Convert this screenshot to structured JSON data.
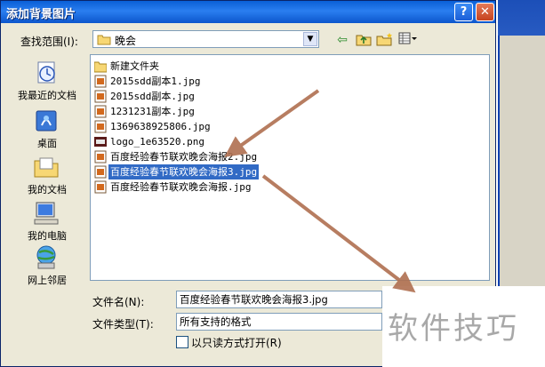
{
  "window": {
    "title": "添加背景图片",
    "help_label": "?",
    "close_label": "✕"
  },
  "lookin": {
    "label": "查找范围(I):",
    "value": "晚会",
    "dropdown_glyph": "▼"
  },
  "toolbar": {
    "back_glyph": "⇦",
    "up_glyph": "⇧",
    "newfolder_glyph": "✱",
    "views_glyph": "▦"
  },
  "places": [
    {
      "label": "我最近的文档",
      "icon": "recent-documents-icon"
    },
    {
      "label": "桌面",
      "icon": "desktop-icon"
    },
    {
      "label": "我的文档",
      "icon": "my-documents-icon"
    },
    {
      "label": "我的电脑",
      "icon": "my-computer-icon"
    },
    {
      "label": "网上邻居",
      "icon": "network-places-icon"
    }
  ],
  "files": [
    {
      "name": "新建文件夹",
      "type": "folder"
    },
    {
      "name": "2015sdd副本1.jpg",
      "type": "jpg"
    },
    {
      "name": "2015sdd副本.jpg",
      "type": "jpg"
    },
    {
      "name": "1231231副本.jpg",
      "type": "jpg"
    },
    {
      "name": "1369638925806.jpg",
      "type": "jpg"
    },
    {
      "name": "logo_1e63520.png",
      "type": "png"
    },
    {
      "name": "百度经验春节联欢晚会海报2.jpg",
      "type": "jpg"
    },
    {
      "name": "百度经验春节联欢晚会海报3.jpg",
      "type": "jpg",
      "selected": true
    },
    {
      "name": "百度经验春节联欢晚会海报.jpg",
      "type": "jpg"
    }
  ],
  "filename": {
    "label": "文件名(N):",
    "value": "百度经验春节联欢晚会海报3.jpg"
  },
  "filetype": {
    "label": "文件类型(T):",
    "value": "所有支持的格式"
  },
  "readonly": {
    "label": "以只读方式打开(R)",
    "checked": false
  },
  "watermark": "软件技巧",
  "colors": {
    "titlebar": "#0a5fd6",
    "selection": "#316ac5",
    "arrow": "#b07050",
    "dialog_bg": "#ece9d8"
  }
}
